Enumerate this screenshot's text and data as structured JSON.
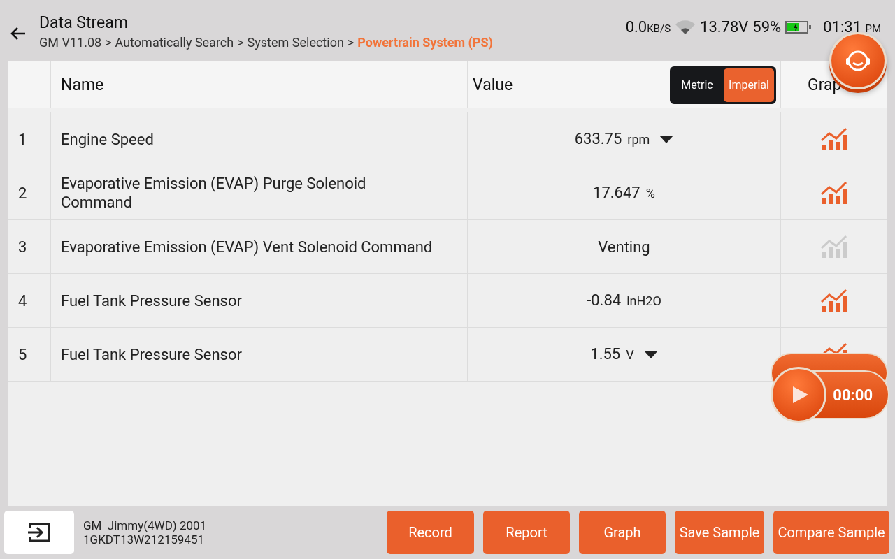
{
  "header": {
    "title": "Data Stream",
    "breadcrumb": [
      {
        "label": "GM V11.08",
        "current": false
      },
      {
        "label": "Automatically Search",
        "current": false
      },
      {
        "label": "System Selection",
        "current": false
      },
      {
        "label": "Powertrain System (PS)",
        "current": true
      }
    ],
    "separator": ">"
  },
  "status_bar": {
    "speed": "0.0",
    "speed_unit": "KB/S",
    "voltage": "13.78V",
    "battery": "59%",
    "time": "01:31",
    "ampm": "PM"
  },
  "table": {
    "columns": [
      "Name",
      "Value",
      "Grap"
    ],
    "units_toggle": [
      {
        "label": "Metric",
        "selected": false
      },
      {
        "label": "Imperial",
        "selected": true
      }
    ],
    "rows": [
      {
        "index": "1",
        "name": "Engine Speed",
        "value": "633.75",
        "unit": "rpm",
        "has_menu": true,
        "graph_enabled": true
      },
      {
        "index": "2",
        "name": "Evaporative Emission (EVAP) Purge Solenoid Command",
        "value": "17.647",
        "unit": "%",
        "has_menu": false,
        "graph_enabled": true
      },
      {
        "index": "3",
        "name": "Evaporative Emission (EVAP) Vent Solenoid Command",
        "value": "Venting",
        "has_menu": false,
        "graph_enabled": false
      },
      {
        "index": "4",
        "name": "Fuel Tank Pressure Sensor",
        "value": "-0.84",
        "unit": "inH2O",
        "has_menu": false,
        "graph_enabled": true
      },
      {
        "index": "5",
        "name": "Fuel Tank Pressure Sensor",
        "value": "1.55",
        "unit": "V",
        "has_menu": true,
        "graph_enabled": true
      }
    ]
  },
  "recorder": {
    "time": "00:00"
  },
  "vehicle": {
    "model": "GM  Jimmy(4WD) 2001",
    "vin": "1GKDT13W212159451"
  },
  "buttons": [
    "Record",
    "Report",
    "Graph",
    "Save Sample",
    "Compare Sample"
  ]
}
